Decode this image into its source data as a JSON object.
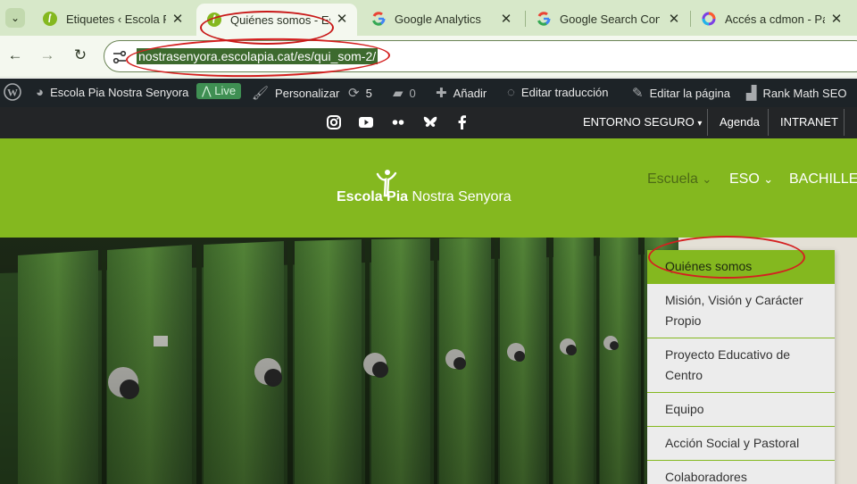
{
  "browser": {
    "tabs": [
      {
        "title": "Etiquetes ‹ Escola Pia",
        "icon": "escola-pia-favicon",
        "active": false
      },
      {
        "title": "Quiénes somos - Esco",
        "icon": "escola-pia-favicon",
        "active": true
      },
      {
        "title": "Google Analytics",
        "icon": "google-favicon",
        "active": false
      },
      {
        "title": "Google Search Conso",
        "icon": "google-favicon",
        "active": false
      },
      {
        "title": "Accés a cdmon - Pane",
        "icon": "cdmon-favicon",
        "active": false
      }
    ],
    "url": "nostrasenyora.escolapia.cat/es/qui_som-2/"
  },
  "adminbar": {
    "site_name": "Escola Pia Nostra Senyora",
    "live_label": "Live",
    "customize_label": "Personalizar",
    "updates_count": "5",
    "comments_count": "0",
    "new_label": "Añadir",
    "translate_label": "Editar traducción",
    "edit_label": "Editar la página",
    "rankmath_label": "Rank Math SEO"
  },
  "topbar": {
    "social_icons": [
      "instagram-icon",
      "youtube-icon",
      "flickr-icon",
      "bluesky-icon",
      "facebook-icon"
    ],
    "secure_label": "ENTORNO SEGURO",
    "agenda_label": "Agenda",
    "intranet_label": "INTRANET"
  },
  "header": {
    "logo_word_1": "Escola",
    "logo_word_2": "Pia",
    "logo_word_3": "Nostra Senyora",
    "nav": [
      {
        "label": "Escuela",
        "dropdown": true,
        "current": true
      },
      {
        "label": "ESO",
        "dropdown": true,
        "current": false
      },
      {
        "label": "BACHILLER",
        "dropdown": false,
        "current": false
      }
    ]
  },
  "dropdown": {
    "items": [
      {
        "label": "Quiénes somos",
        "active": true
      },
      {
        "label": "Misión, Visión y Carácter Propio",
        "active": false
      },
      {
        "label": "Proyecto Educativo de Centro",
        "active": false
      },
      {
        "label": "Equipo",
        "active": false
      },
      {
        "label": "Acción Social y Pastoral",
        "active": false
      },
      {
        "label": "Colaboradores",
        "active": false
      }
    ]
  },
  "colors": {
    "brand_green": "#84b81f",
    "admin_bar": "#1d2327",
    "top_bar": "#232527",
    "annotation_red": "#d42020"
  }
}
